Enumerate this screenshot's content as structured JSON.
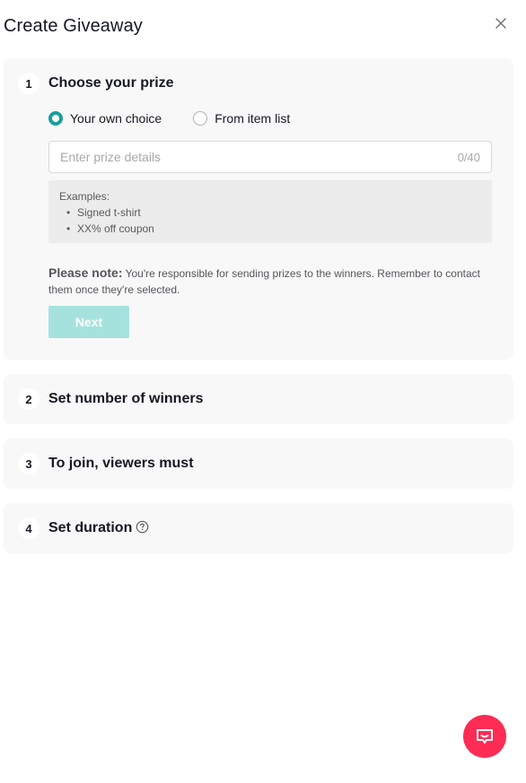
{
  "header": {
    "title": "Create Giveaway",
    "close_icon": "close-icon"
  },
  "steps": [
    {
      "number": "1",
      "title": "Choose your prize",
      "prize_options": [
        {
          "label": "Your own choice",
          "checked": true
        },
        {
          "label": "From item list",
          "checked": false
        }
      ],
      "prize_input": {
        "value": "",
        "placeholder": "Enter prize details",
        "counter": "0/40"
      },
      "examples": {
        "heading": "Examples:",
        "items": [
          "Signed t-shirt",
          "XX% off coupon"
        ]
      },
      "note": {
        "label": "Please note:",
        "text": " You're responsible for sending prizes to the winners. Remember to contact them once they're selected."
      },
      "next_label": "Next"
    },
    {
      "number": "2",
      "title": "Set number of winners"
    },
    {
      "number": "3",
      "title": "To join, viewers must"
    },
    {
      "number": "4",
      "title": "Set duration",
      "help_icon": "help-icon"
    }
  ],
  "colors": {
    "accent": "#1a9e9a",
    "next_disabled": "#a6e2dd",
    "fab": "#fe2c55",
    "card_bg": "#f8f8f8"
  },
  "fab": {
    "icon": "chat-feedback-icon"
  }
}
